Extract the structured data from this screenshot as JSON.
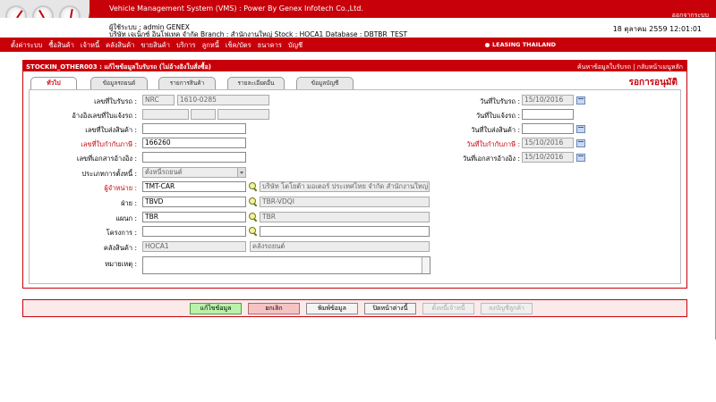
{
  "header": {
    "app_title": "Vehicle Management System (VMS) : Power By Genex Infotech Co.,Ltd.",
    "logout": "ออกจากระบบ",
    "user_line": "ผู้ใช้ระบบ : admin GENEX",
    "company_line": "บริษัท เจเน็กซ์ อินโฟเทค จำกัด Branch : สำนักงานใหญ่ Stock : HOCA1 Database : DBTBR_TEST",
    "datetime": "18 ตุลาคม 2559 12:01:01"
  },
  "menu": {
    "items": [
      "ตั้งค่าระบบ",
      "ซื้อสินค้า",
      "เจ้าหนี้",
      "คลังสินค้า",
      "ขายสินค้า",
      "บริการ",
      "ลูกหนี้",
      "เช็ค/บัตร",
      "ธนาคาร",
      "บัญชี"
    ],
    "leasing": "LEASING THAILAND"
  },
  "panel": {
    "title": "STOCKIN_OTHER003 : แก้ไขข้อมูลใบรับรถ (ไม่อ้างอิงใบสั่งซื้อ)",
    "right_links": "ค้นหาข้อมูลใบรับรถ | กลับหน้าเมนูหลัก",
    "status": "รอการอนุมัติ",
    "tabs": [
      "ทั่วไป",
      "ข้อมูลรถยนต์",
      "รายการสินค้า",
      "รายละเอียดอื่น",
      "ข้อมูลบัญชี"
    ]
  },
  "form": {
    "labels": {
      "receipt_no": "เลขที่ใบรับรถ :",
      "ref_transfer": "อ้างอิงเลขที่ใบแจ้งรถ :",
      "delivery_no": "เลขที่ใบส่งสินค้า :",
      "tax_invoice_no": "เลขที่ใบกำกับภาษี :",
      "ref_doc_no": "เลขที่เอกสารอ้างอิง :",
      "debt_type": "ประเภทการตั้งหนี้ :",
      "vendor": "ผู้จำหน่าย :",
      "department": "ฝ่าย :",
      "section": "แผนก :",
      "project": "โครงการ :",
      "warehouse": "คลังสินค้า :",
      "remark": "หมายเหตุ :",
      "receipt_date": "วันที่ใบรับรถ :",
      "transfer_date": "วันที่ใบแจ้งรถ :",
      "delivery_date": "วันที่ใบส่งสินค้า :",
      "tax_invoice_date": "วันที่ใบกำกับภาษี :",
      "ref_doc_date": "วันที่เอกสารอ้างอิง :"
    },
    "values": {
      "receipt_prefix": "NRC",
      "receipt_no": "1610-0285",
      "tax_invoice_no": "166260",
      "debt_type": "ตั้งหนี้รถยนต์",
      "vendor_code": "TMT-CAR",
      "vendor_name": "บริษัท โตโยต้า มอเตอร์ ประเทศไทย จำกัด สำนักงานใหญ่",
      "department_code": "TBVD",
      "department_name": "TBR-VDQI",
      "section_code": "TBR",
      "section_name": "TBR",
      "warehouse_code": "HOCA1",
      "warehouse_name": "คลังรถยนต์",
      "receipt_date": "15/10/2016",
      "tax_invoice_date": "15/10/2016",
      "ref_doc_date": "15/10/2016"
    }
  },
  "buttons": {
    "save": "แก้ไขข้อมูล",
    "cancel": "ยกเลิก",
    "print": "พิมพ์ข้อมูล",
    "close": "ปิดหน้าต่างนี้",
    "set_debt": "ตั้งหนี้เจ้าหนี้",
    "post_account": "ลงบัญชีลูกค้า"
  },
  "colors": {
    "brand": "#c8000a",
    "save_btn": "#b9f2a8",
    "cancel_btn": "#f6c3c3"
  }
}
